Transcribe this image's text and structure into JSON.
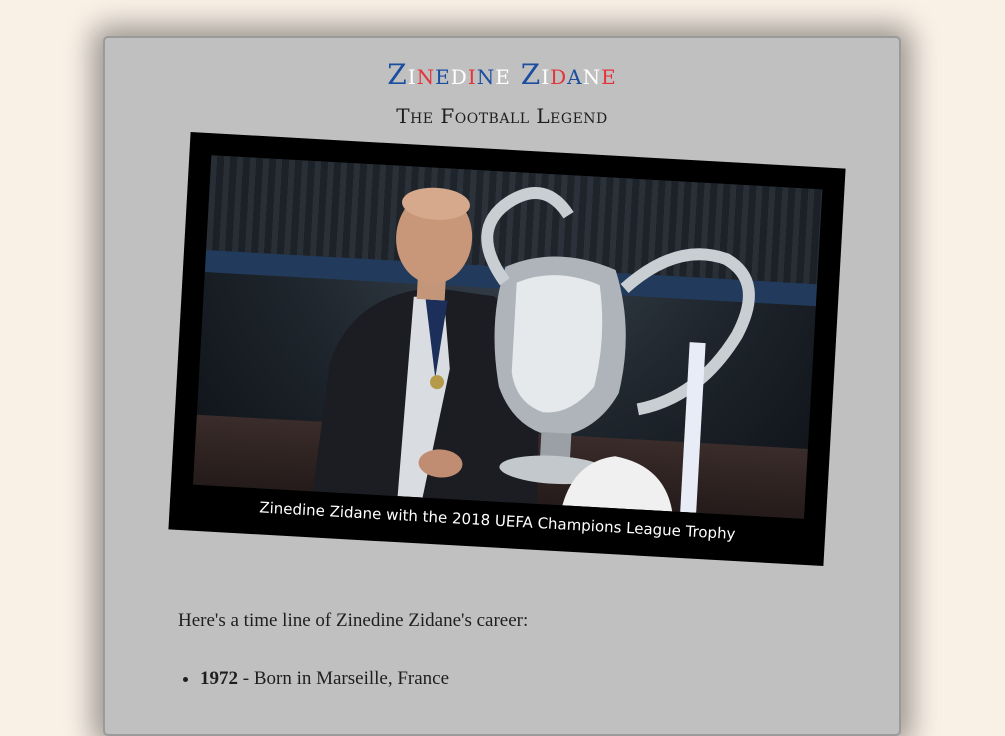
{
  "header": {
    "title_letters": [
      "Z",
      "i",
      "n",
      "e",
      "d",
      "i",
      "n",
      "e",
      " ",
      "Z",
      "i",
      "d",
      "a",
      "n",
      "e"
    ],
    "title_colors": [
      "#1b4ea0",
      "#ffffff",
      "#e4343a"
    ],
    "subtitle": "The Football Legend"
  },
  "figure": {
    "image_alt": "Zinedine Zidane holding the UEFA Champions League trophy",
    "caption": "Zinedine Zidane with the 2018 UEFA Champions League Trophy"
  },
  "content": {
    "intro": "Here's a time line of Zinedine Zidane's career:",
    "timeline": [
      {
        "year": "1972",
        "event": " - Born in Marseille, France"
      }
    ]
  }
}
